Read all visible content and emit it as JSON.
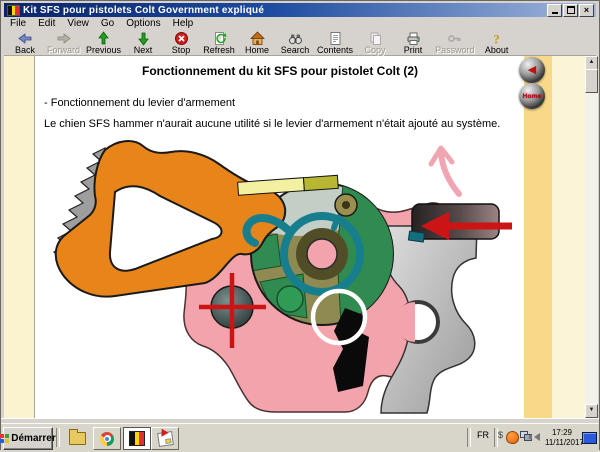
{
  "window": {
    "title": "Kit SFS pour pistolets Colt Government expliqué",
    "close_glyph": "×"
  },
  "menu": {
    "items": [
      "File",
      "Edit",
      "View",
      "Go",
      "Options",
      "Help"
    ]
  },
  "toolbar": {
    "buttons": [
      {
        "label": "Back",
        "enabled": true
      },
      {
        "label": "Forward",
        "enabled": false
      },
      {
        "label": "Previous",
        "enabled": true
      },
      {
        "label": "Next",
        "enabled": true
      },
      {
        "label": "Stop",
        "enabled": true
      },
      {
        "label": "Refresh",
        "enabled": true
      },
      {
        "label": "Home",
        "enabled": true
      },
      {
        "label": "Search",
        "enabled": true
      },
      {
        "label": "Contents",
        "enabled": true
      },
      {
        "label": "Copy",
        "enabled": false
      },
      {
        "label": "Print",
        "enabled": true
      },
      {
        "label": "Password",
        "enabled": false
      },
      {
        "label": "About",
        "enabled": true
      }
    ]
  },
  "content": {
    "title": "Fonctionnement du kit SFS pour pistolet Colt (2)",
    "line1": "- Fonctionnement du levier d'armement",
    "line2": "Le chien SFS hammer n'aurait aucune utilité si le levier d'armement n'était ajouté au système.",
    "nav": {
      "back_glyph": "◀",
      "home_label": "Home"
    },
    "scrollbar": {
      "up_glyph": "▲",
      "down_glyph": "▼"
    }
  },
  "taskbar": {
    "start_label": "Démarrer",
    "tray": {
      "language": "FR",
      "dollar_glyph": "$",
      "time": "17:29",
      "date": "11/11/2017"
    }
  },
  "colors": {
    "titlebar_l": "#0a246a",
    "titlebar_r": "#a3b8dc",
    "chrome": "#d6d3ce",
    "cream": "#fbf2cf",
    "gold": "#f7d989",
    "cream_light": "#fcf4d6",
    "page_white": "#ffffff",
    "taskbar": "#d8d5ca",
    "orange": "#e8851a",
    "pink": "#f2a3ab",
    "pink_arrow": "#efa6b2",
    "khaki": "#8f8a52",
    "light_seg": "#c2cec6",
    "green": "#2f8b50",
    "teal": "#177e8e",
    "dark_olive": "#514d26",
    "red": "#cc1414"
  }
}
